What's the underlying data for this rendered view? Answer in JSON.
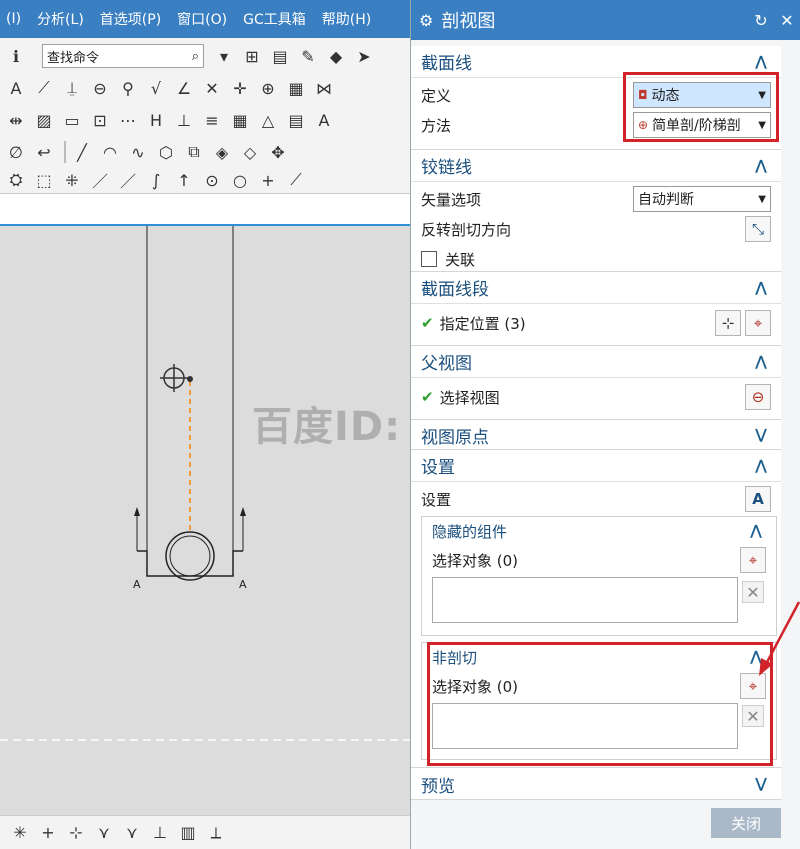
{
  "menubar": {
    "items": [
      "(I)",
      "分析(L)",
      "首选项(P)",
      "窗口(O)",
      "GC工具箱",
      "帮助(H)"
    ]
  },
  "toolbar": {
    "search_placeholder": "查找命令",
    "row1_icons": [
      "info-icon",
      "search-icon",
      "dropdown-icon",
      "view-icon",
      "layers-icon",
      "pencil-icon",
      "color-icon",
      "arrow-icon"
    ],
    "row2_icons": [
      "text-icon",
      "line-icon",
      "pin-icon",
      "zoom-icon",
      "measure-icon",
      "check-icon",
      "angle-icon",
      "cross-icon",
      "snap-icon",
      "target-icon",
      "image-icon",
      "arrow-icon"
    ]
  },
  "graphic": {
    "watermark": "百度ID: ffjczr",
    "section_labels": [
      "A",
      "A"
    ]
  },
  "dialog": {
    "title": "剖视图",
    "sections": {
      "hatch": {
        "title": "截面线",
        "define_label": "定义",
        "define_value": "动态",
        "method_label": "方法",
        "method_value": "简单剖/阶梯剖"
      },
      "hinge": {
        "title": "铰链线",
        "vector_label": "矢量选项",
        "vector_value": "自动判断",
        "reverse_label": "反转剖切方向",
        "assoc_label": "关联"
      },
      "hatch_segment": {
        "title": "截面线段",
        "specify_label": "指定位置 (3)"
      },
      "parent_view": {
        "title": "父视图",
        "select_label": "选择视图"
      },
      "view_origin": {
        "title": "视图原点"
      },
      "settings": {
        "title": "设置",
        "settings_label": "设置",
        "hidden": {
          "title": "隐藏的组件",
          "select_label": "选择对象 (0)"
        },
        "non_section": {
          "title": "非剖切",
          "select_label": "选择对象 (0)"
        }
      },
      "preview": {
        "title": "预览"
      }
    },
    "close_label": "关闭"
  }
}
